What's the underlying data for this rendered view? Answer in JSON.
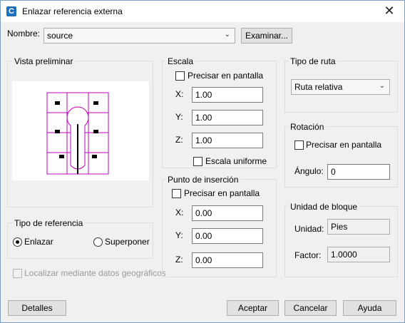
{
  "window": {
    "title": "Enlazar referencia externa",
    "close_symbol": "✕",
    "app_icon_letter": "C"
  },
  "name_row": {
    "label": "Nombre:",
    "value": "source",
    "browse_label": "Examinar..."
  },
  "preview": {
    "title": "Vista preliminar"
  },
  "scale": {
    "title": "Escala",
    "specify_label": "Precisar en pantalla",
    "x_label": "X:",
    "x_value": "1.00",
    "y_label": "Y:",
    "y_value": "1.00",
    "z_label": "Z:",
    "z_value": "1.00",
    "uniform_label": "Escala uniforme"
  },
  "path_type": {
    "title": "Tipo de ruta",
    "value": "Ruta relativa"
  },
  "rotation": {
    "title": "Rotación",
    "specify_label": "Precisar en pantalla",
    "angle_label": "Ángulo:",
    "angle_value": "0"
  },
  "insertion": {
    "title": "Punto de inserción",
    "specify_label": "Precisar en pantalla",
    "x_label": "X:",
    "x_value": "0.00",
    "y_label": "Y:",
    "y_value": "0.00",
    "z_label": "Z:",
    "z_value": "0.00"
  },
  "block_unit": {
    "title": "Unidad de bloque",
    "unit_label": "Unidad:",
    "unit_value": "Pies",
    "factor_label": "Factor:",
    "factor_value": "1.0000"
  },
  "reference_type": {
    "title": "Tipo de referencia",
    "attach_label": "Enlazar",
    "overlay_label": "Superponer",
    "selected": "Enlazar"
  },
  "geo": {
    "label": "Localizar mediante datos geográficos"
  },
  "buttons": {
    "details": "Detalles",
    "ok": "Aceptar",
    "cancel": "Cancelar",
    "help": "Ayuda"
  },
  "colors": {
    "preview_stroke": "#c000c0",
    "accent": "#1d6fc0"
  }
}
